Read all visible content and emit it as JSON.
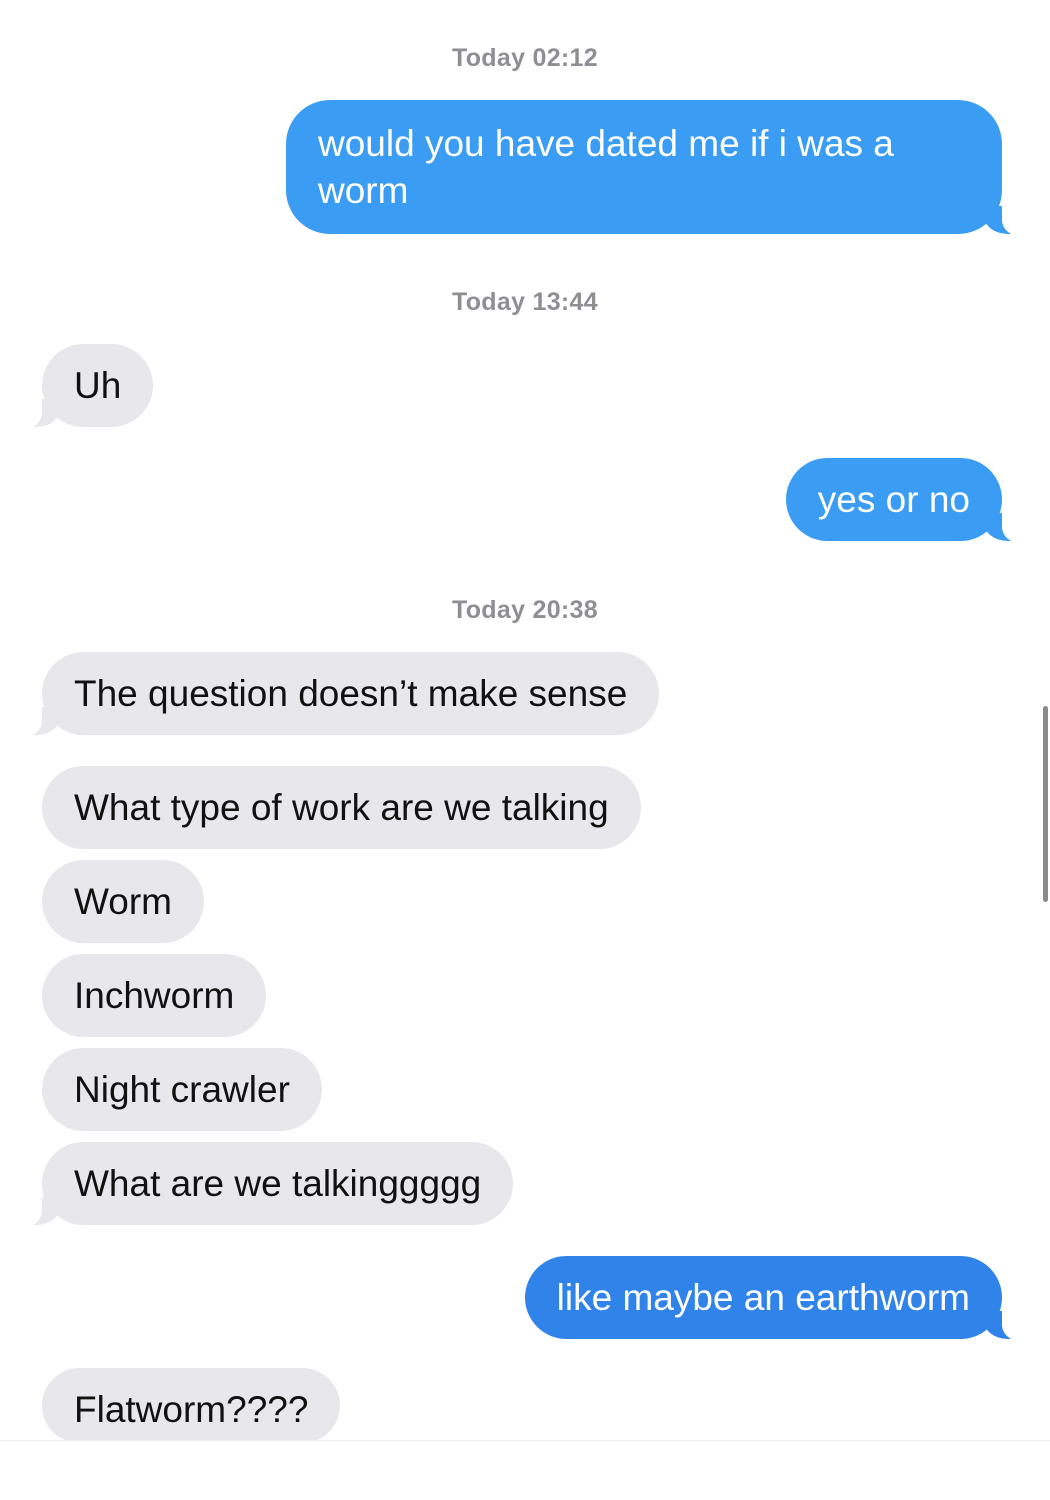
{
  "conversation": {
    "timestamps": [
      "Today 02:12",
      "Today 13:44",
      "Today 20:38"
    ],
    "messages": [
      {
        "sender": "me",
        "text": "would you have dated me if i was a worm"
      },
      {
        "sender": "them",
        "text": "Uh"
      },
      {
        "sender": "me",
        "text": "yes or no"
      },
      {
        "sender": "them",
        "text": "The question doesn’t make sense"
      },
      {
        "sender": "them",
        "text": "What type of work are we talking"
      },
      {
        "sender": "them",
        "text": "Worm"
      },
      {
        "sender": "them",
        "text": "Inchworm"
      },
      {
        "sender": "them",
        "text": "Night crawler"
      },
      {
        "sender": "them",
        "text": "What are we talkinggggg"
      },
      {
        "sender": "me",
        "text": "like maybe an earthworm"
      },
      {
        "sender": "them",
        "text": "Flatworm????"
      }
    ]
  },
  "colors": {
    "sent_bubble": "#3a9cf2",
    "received_bubble": "#e7e7ec",
    "timestamp_text": "#8e8e93"
  }
}
